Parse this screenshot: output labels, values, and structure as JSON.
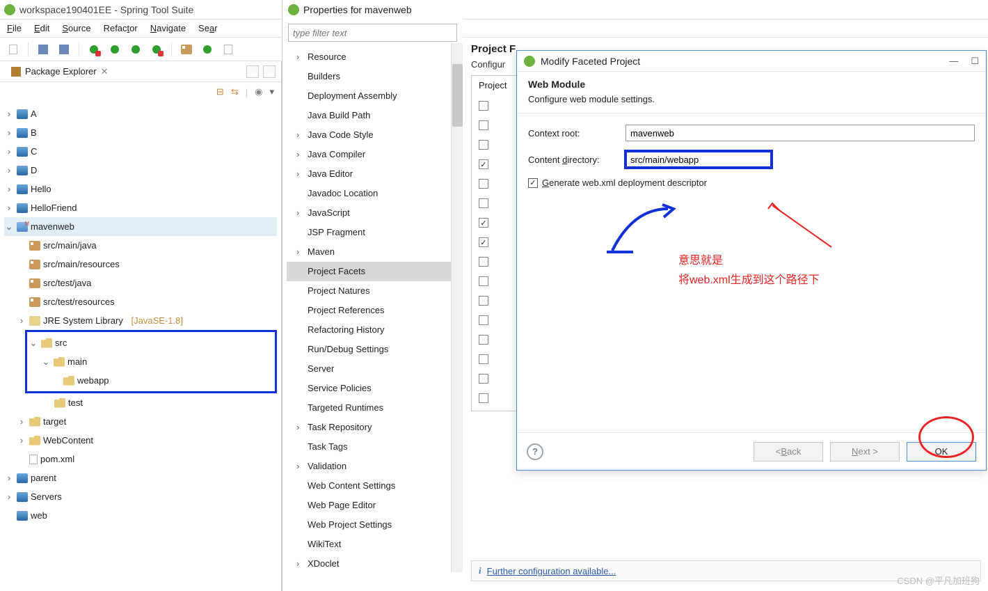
{
  "window": {
    "title": "workspace190401EE - Spring Tool Suite"
  },
  "menu": {
    "file": "File",
    "edit": "Edit",
    "source": "Source",
    "refactor": "Refactor",
    "navigate": "Navigate",
    "search": "Sear"
  },
  "pkg": {
    "tab": "Package Explorer",
    "projects": [
      "A",
      "B",
      "C",
      "D",
      "Hello",
      "HelloFriend"
    ],
    "mavenweb": {
      "name": "mavenweb",
      "srcfolders": [
        "src/main/java",
        "src/main/resources",
        "src/test/java",
        "src/test/resources"
      ],
      "lib": "JRE System Library",
      "libver": "[JavaSE-1.8]",
      "src": "src",
      "main": "main",
      "webapp": "webapp",
      "test": "test",
      "target": "target",
      "webcontent": "WebContent",
      "pom": "pom.xml"
    },
    "bottom": [
      "parent",
      "Servers",
      "web"
    ]
  },
  "props": {
    "title": "Properties for mavenweb",
    "filter_placeholder": "type filter text",
    "items": [
      "Resource",
      "Builders",
      "Deployment Assembly",
      "Java Build Path",
      "Java Code Style",
      "Java Compiler",
      "Java Editor",
      "Javadoc Location",
      "JavaScript",
      "JSP Fragment",
      "Maven",
      "Project Facets",
      "Project Natures",
      "Project References",
      "Refactoring History",
      "Run/Debug Settings",
      "Server",
      "Service Policies",
      "Targeted Runtimes",
      "Task Repository",
      "Task Tags",
      "Validation",
      "Web Content Settings",
      "Web Page Editor",
      "Web Project Settings",
      "WikiText",
      "XDoclet"
    ],
    "expandable": [
      0,
      4,
      5,
      6,
      8,
      10,
      19,
      21,
      26
    ],
    "selected": "Project Facets"
  },
  "right": {
    "title": "Project F",
    "config": "Configur",
    "boxhead": "Project",
    "facets_checked": [
      false,
      false,
      false,
      true,
      false,
      false,
      true,
      true,
      false,
      false,
      false,
      false,
      false,
      false,
      false,
      false
    ],
    "info": "Further configuration available..."
  },
  "modal": {
    "title": "Modify Faceted Project",
    "heading": "Web Module",
    "subtitle": "Configure web module settings.",
    "contextroot_label": "Context root:",
    "contextroot_value": "mavenweb",
    "contentdir_label": "Content directory:",
    "contentdir_value": "src/main/webapp",
    "gen_label": "Generate web.xml deployment descriptor",
    "back": "< Back",
    "next": "Next >",
    "ok": "OK"
  },
  "annotations": {
    "line1": "意思就是",
    "line2": "将web.xml生成到这个路径下"
  },
  "watermark": "CSDN @平凡加班狗"
}
